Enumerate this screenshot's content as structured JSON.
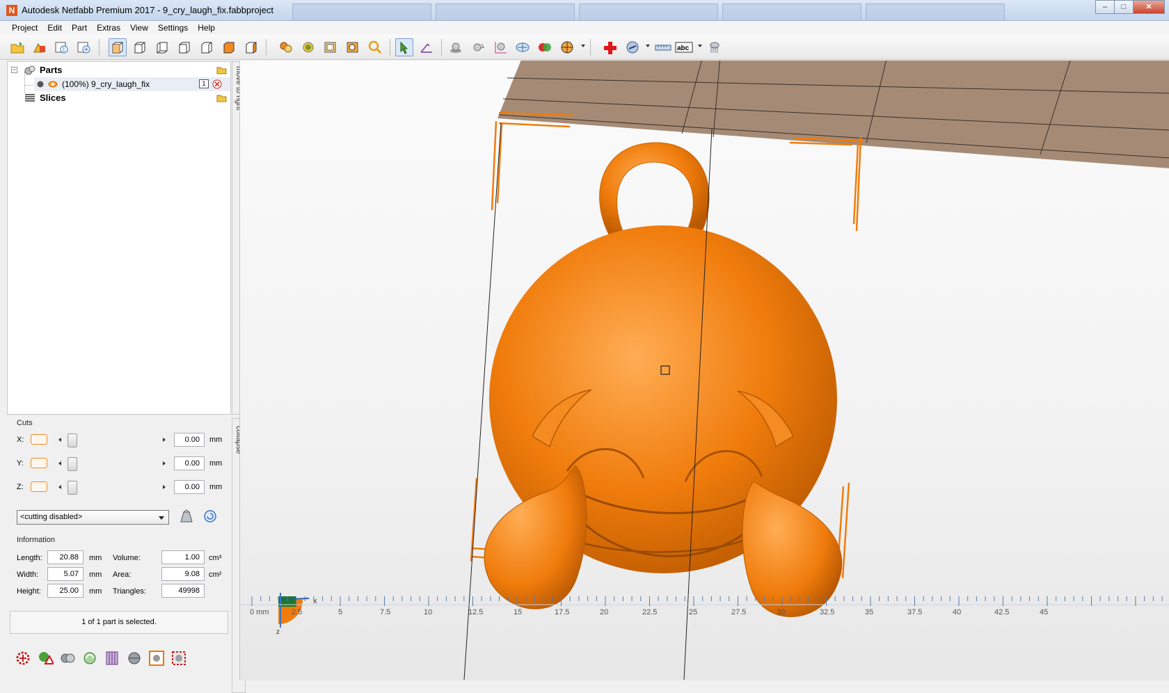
{
  "window": {
    "title": "Autodesk Netfabb Premium 2017 - 9_cry_laugh_fix.fabbproject",
    "logo_letter": "N"
  },
  "menu": [
    "Project",
    "Edit",
    "Part",
    "Extras",
    "View",
    "Settings",
    "Help"
  ],
  "tree": {
    "parts_label": "Parts",
    "part_item": "(100%) 9_cry_laugh_fix",
    "part_badge": "1",
    "slices_label": "Slices"
  },
  "side_tabs": {
    "top": "move to right",
    "bottom": "collapse"
  },
  "cuts": {
    "title": "Cuts",
    "rows": [
      {
        "axis": "X:",
        "value": "0.00",
        "unit": "mm"
      },
      {
        "axis": "Y:",
        "value": "0.00",
        "unit": "mm"
      },
      {
        "axis": "Z:",
        "value": "0.00",
        "unit": "mm"
      }
    ],
    "mode": "<cutting disabled>"
  },
  "information": {
    "title": "Information",
    "length_label": "Length:",
    "length": "20.88",
    "length_unit": "mm",
    "width_label": "Width:",
    "width": "5.07",
    "width_unit": "mm",
    "height_label": "Height:",
    "height": "25.00",
    "height_unit": "mm",
    "volume_label": "Volume:",
    "volume": "1.00",
    "volume_unit": "cm³",
    "area_label": "Area:",
    "area": "9.08",
    "area_unit": "cm²",
    "triangles_label": "Triangles:",
    "triangles": "49998"
  },
  "status": "1 of 1 part is selected.",
  "viewport": {
    "ruler_labels": [
      "0 mm",
      "2.5",
      "5",
      "7.5",
      "10",
      "12.5",
      "15",
      "17.5",
      "20",
      "22.5",
      "25",
      "27.5",
      "30",
      "32.5",
      "35",
      "37.5",
      "40",
      "42.5",
      "45"
    ],
    "axis_x": "x",
    "axis_z": "z"
  },
  "colors": {
    "model_orange": "#f07c0c",
    "platform": "#a58b76",
    "bbox_orange": "#f07c0c"
  }
}
